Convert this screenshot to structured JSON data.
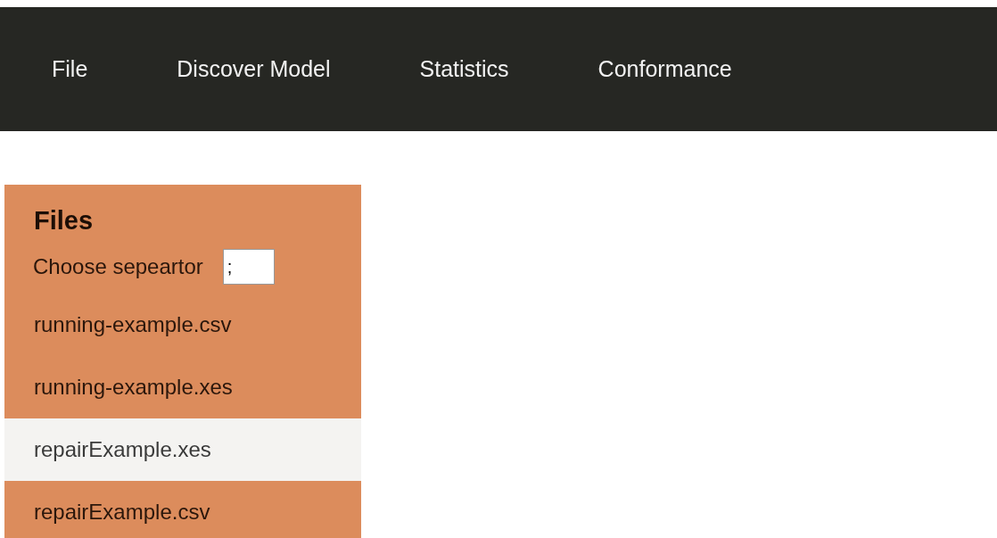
{
  "menu": [
    {
      "label": "File"
    },
    {
      "label": "Discover Model"
    },
    {
      "label": "Statistics"
    },
    {
      "label": "Conformance"
    }
  ],
  "sidebar": {
    "title": "Files",
    "separator": {
      "label": "Choose sepeartor",
      "value": ";"
    },
    "files": [
      {
        "label": "running-example.csv",
        "selected": false
      },
      {
        "label": "running-example.xes",
        "selected": false
      },
      {
        "label": "repairExample.xes",
        "selected": true
      },
      {
        "label": "repairExample.csv",
        "selected": false
      }
    ]
  }
}
